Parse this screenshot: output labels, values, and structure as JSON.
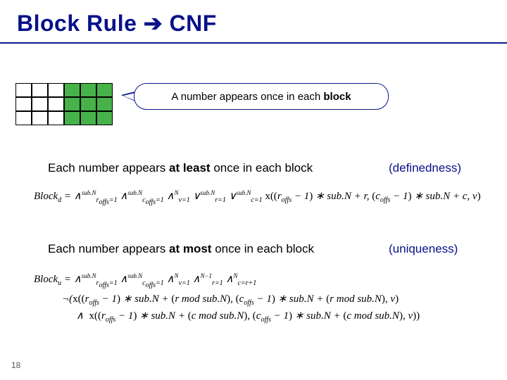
{
  "title_left": "Block Rule",
  "title_right": "CNF",
  "bubble_text": "A number appears once in each ",
  "bubble_bold": "block",
  "stmt1_pre": "Each number appears ",
  "stmt1_bold": "at least",
  "stmt1_post": " once in each block",
  "tag1": "(definedness)",
  "stmt2_pre": "Each number appears ",
  "stmt2_bold": "at most",
  "stmt2_post": " once in each block",
  "tag2": "(uniqueness)",
  "formula1": "Block<sub>d</sub> = ∧<sup>sub.N</sup><sub>r<sub>offs</sub>=1</sub> ∧<sup>sub.N</sup><sub>c<sub>offs</sub>=1</sub> ∧<sup>N</sup><sub>v=1</sub> ∨<sup>sub.N</sup><sub>r=1</sub> ∨<sup>sub.N</sup><sub>c=1</sub> <span class=\"up\">x((</span>r<sub>offs</sub> − 1<span class=\"up\">)</span> ∗ sub.N + r, <span class=\"up\">(</span>c<sub>offs</sub> − 1<span class=\"up\">)</span> ∗ sub.N + c, v<span class=\"up\">)</span>",
  "formula2_l1": "Block<sub>u</sub> = ∧<sup>sub.N</sup><sub>r<sub>offs</sub>=1</sub> ∧<sup>sub.N</sup><sub>c<sub>offs</sub>=1</sub> ∧<sup>N</sup><sub>v=1</sub> ∧<sup>N−1</sup><sub>r=1</sub> ∧<sup>N</sup><sub>c=r+1</sub>",
  "formula2_l2": "¬(<span class=\"up\">x((</span>r<sub>offs</sub> − 1<span class=\"up\">)</span> ∗ sub.N + <span class=\"up\">(</span>r&nbsp;mod&nbsp;sub.N<span class=\"up\">)</span>, <span class=\"up\">(</span>c<sub>offs</sub> − 1<span class=\"up\">)</span> ∗ sub.N + <span class=\"up\">(</span>r&nbsp;mod&nbsp;sub.N<span class=\"up\">)</span>, v<span class=\"up\">)</span>",
  "formula2_l3": "∧ &nbsp;<span class=\"up\">x((</span>r<sub>offs</sub> − 1<span class=\"up\">)</span> ∗ sub.N + <span class=\"up\">(</span>c&nbsp;mod&nbsp;sub.N<span class=\"up\">)</span>, <span class=\"up\">(</span>c<sub>offs</sub> − 1<span class=\"up\">)</span> ∗ sub.N + <span class=\"up\">(</span>c&nbsp;mod&nbsp;sub.N<span class=\"up\">)</span>, v<span class=\"up\">))</span>",
  "pagenum": "18"
}
